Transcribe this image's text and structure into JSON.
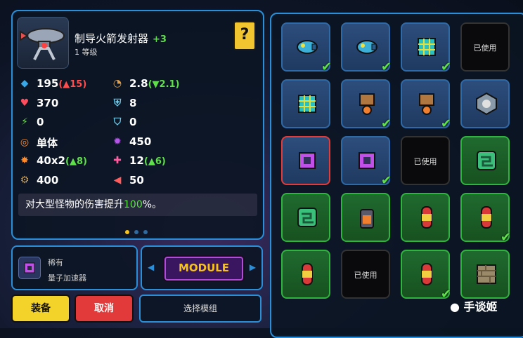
{
  "weapon": {
    "name": "制导火箭发射器",
    "plus": "+3",
    "level": "1 等级",
    "help_icon": "?"
  },
  "stats": [
    {
      "icon": "damage-icon",
      "symbol": "◆",
      "color": "#38a8e8",
      "value": "195",
      "delta": "(▲15)",
      "delta_color": "red"
    },
    {
      "icon": "cooldown-icon",
      "symbol": "◔",
      "color": "#e0a050",
      "value": "2.8",
      "delta": "(▼2.1)",
      "delta_color": "green"
    },
    {
      "icon": "heart-icon",
      "symbol": "♥",
      "color": "#ff4d5d",
      "value": "370",
      "delta": "",
      "delta_color": ""
    },
    {
      "icon": "shield-icon",
      "symbol": "⛨",
      "color": "#6ac8e8",
      "value": "8",
      "delta": "",
      "delta_color": ""
    },
    {
      "icon": "energy-icon",
      "symbol": "⚡",
      "color": "#6ce04a",
      "value": "0",
      "delta": "",
      "delta_color": ""
    },
    {
      "icon": "shield-down-icon",
      "symbol": "⛉",
      "color": "#6ac8e8",
      "value": "0",
      "delta": "",
      "delta_color": ""
    },
    {
      "icon": "target-icon",
      "symbol": "◎",
      "color": "#ff8a2a",
      "value": "单体",
      "delta": "",
      "delta_color": ""
    },
    {
      "icon": "blast-icon",
      "symbol": "✹",
      "color": "#b455e8",
      "value": "450",
      "delta": "",
      "delta_color": ""
    },
    {
      "icon": "burst-icon",
      "symbol": "✸",
      "color": "#ff8a2a",
      "value": "40x2",
      "delta": "(▲8)",
      "delta_color": "green"
    },
    {
      "icon": "pierce-icon",
      "symbol": "✚",
      "color": "#ff5da0",
      "value": "12",
      "delta": "(▲6)",
      "delta_color": "green"
    },
    {
      "icon": "gear-icon",
      "symbol": "⚙",
      "color": "#c8a060",
      "value": "400",
      "delta": "",
      "delta_color": ""
    },
    {
      "icon": "knockback-icon",
      "symbol": "◀",
      "color": "#ff5d5d",
      "value": "50",
      "delta": "",
      "delta_color": ""
    }
  ],
  "description": {
    "before": "对大型怪物的伤害提升",
    "highlight": "100",
    "after": "%。"
  },
  "module": {
    "rarity": "稀有",
    "name": "量子加速器",
    "button": "MODULE",
    "select": "选择模组"
  },
  "buttons": {
    "equip": "装备",
    "cancel": "取消"
  },
  "grid": [
    {
      "kind": "blue",
      "item": "missile",
      "check": true
    },
    {
      "kind": "blue",
      "item": "missile",
      "check": true
    },
    {
      "kind": "blue",
      "item": "cube",
      "check": true
    },
    {
      "kind": "used",
      "label": "已使用"
    },
    {
      "kind": "blue",
      "item": "cube",
      "check": false
    },
    {
      "kind": "blue",
      "item": "totem",
      "check": true
    },
    {
      "kind": "blue",
      "item": "totem",
      "check": true
    },
    {
      "kind": "blue",
      "item": "drone",
      "check": false
    },
    {
      "kind": "red",
      "item": "chip",
      "check": false
    },
    {
      "kind": "blue",
      "item": "chip",
      "check": true
    },
    {
      "kind": "used",
      "label": "已使用"
    },
    {
      "kind": "green",
      "item": "circuit",
      "check": false
    },
    {
      "kind": "green",
      "item": "circuit",
      "check": false
    },
    {
      "kind": "green",
      "item": "battery",
      "check": false
    },
    {
      "kind": "green",
      "item": "rocket",
      "check": false
    },
    {
      "kind": "green",
      "item": "rocket",
      "check": true
    },
    {
      "kind": "green",
      "item": "rocket",
      "check": false
    },
    {
      "kind": "used",
      "label": "已使用"
    },
    {
      "kind": "green",
      "item": "rocket",
      "check": true
    },
    {
      "kind": "green",
      "item": "plate",
      "check": false
    }
  ],
  "watermark": "手谈姬",
  "colors": {
    "accent": "#2a8fd8",
    "gold": "#f6c21c",
    "positive": "#5fe04a",
    "negative": "#ff4d4d"
  }
}
